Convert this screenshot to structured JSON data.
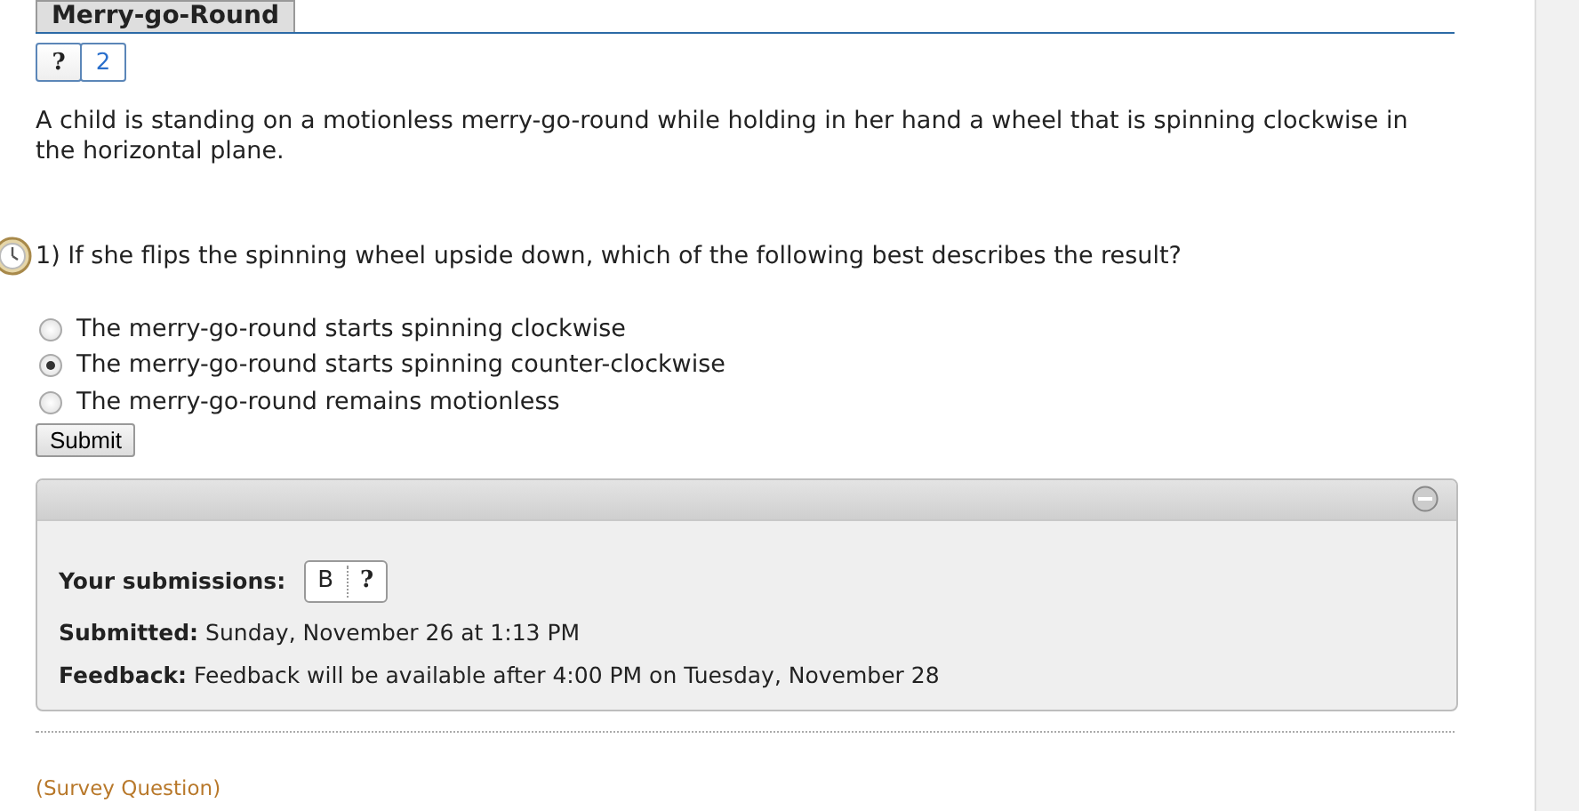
{
  "title": "Merry-go-Round",
  "nav_buttons": [
    {
      "label": "?",
      "kind": "help"
    },
    {
      "label": "2",
      "kind": "link"
    }
  ],
  "intro": "A child is standing on a motionless merry-go-round while holding in her hand a wheel that is spinning clockwise in the horizontal plane.",
  "question": "1) If she flips the spinning wheel upside down, which of the following best describes the result?",
  "options": [
    {
      "label": "The merry-go-round starts spinning clockwise",
      "selected": false
    },
    {
      "label": "The merry-go-round starts spinning counter-clockwise",
      "selected": true
    },
    {
      "label": "The merry-go-round remains motionless",
      "selected": false
    }
  ],
  "submit_button": "Submit",
  "panel": {
    "submissions_label": "Your submissions:",
    "submissions": [
      {
        "label": "B",
        "kind": "answer"
      },
      {
        "label": "?",
        "kind": "help"
      }
    ],
    "submitted_label": "Submitted:",
    "submitted_value": "Sunday, November 26 at 1:13 PM",
    "feedback_label": "Feedback:",
    "feedback_value": "Feedback will be available after 4:00 PM on Tuesday, November 28"
  },
  "next_question_tag": "(Survey Question)"
}
